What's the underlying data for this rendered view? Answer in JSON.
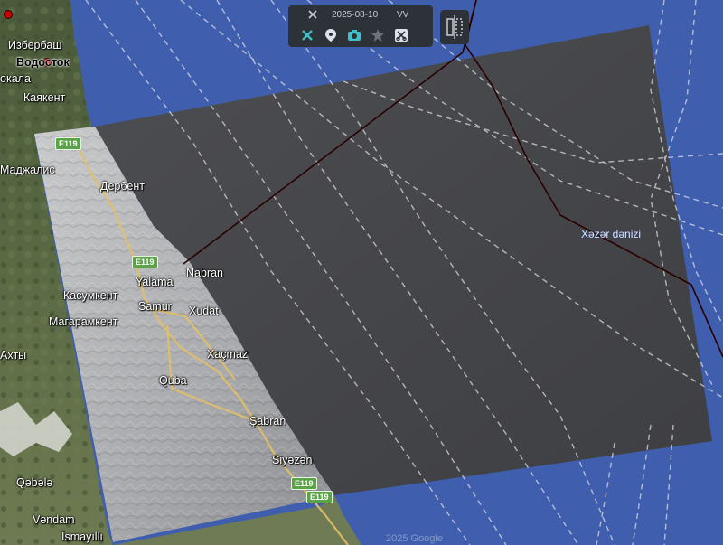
{
  "toolbar": {
    "date": "2025-08-10",
    "polarization": "VV",
    "icons": [
      "satellite-icon",
      "map-pin-icon",
      "camera-icon",
      "star-icon",
      "scissors-icon"
    ]
  },
  "compare_button": {
    "icon": "split-compare-icon"
  },
  "places": [
    {
      "key": "izberbash",
      "text": "Избербаш"
    },
    {
      "key": "vodostok",
      "text": "Водосток"
    },
    {
      "key": "okala",
      "text": "окала"
    },
    {
      "key": "kayakent",
      "text": "Каякент"
    },
    {
      "key": "madzhalis",
      "text": "Маджалис"
    },
    {
      "key": "derbent",
      "text": "Дербент"
    },
    {
      "key": "nabran",
      "text": "Nabran"
    },
    {
      "key": "yalama",
      "text": "Yalama"
    },
    {
      "key": "kasumkent",
      "text": "Касумкент"
    },
    {
      "key": "samur",
      "text": "Samur"
    },
    {
      "key": "xudat",
      "text": "Xudat"
    },
    {
      "key": "magaramkent",
      "text": "Магарамкент"
    },
    {
      "key": "xachmaz",
      "text": "Xaçmaz"
    },
    {
      "key": "akhty",
      "text": "Ахты"
    },
    {
      "key": "quba",
      "text": "Quba"
    },
    {
      "key": "shabran",
      "text": "Şabran"
    },
    {
      "key": "siyazan",
      "text": "Siyəzən"
    },
    {
      "key": "qabala",
      "text": "Qəbələ"
    },
    {
      "key": "vandam",
      "text": "Vəndam"
    },
    {
      "key": "ismayilli",
      "text": "İsmayıllı"
    }
  ],
  "sea_label": "Xəzər dənizi",
  "road_shields": [
    "E119",
    "E119",
    "E119",
    "E119"
  ],
  "watermark": "2025 Google",
  "colors": {
    "sea": "#3f5fae",
    "toolbar_bg": "#2d3238",
    "toolbar_accent": "#3fc1c9",
    "border_line": "#2a0000",
    "shipping_lanes": "#d9dce6",
    "road_shield": "#5aa447"
  }
}
